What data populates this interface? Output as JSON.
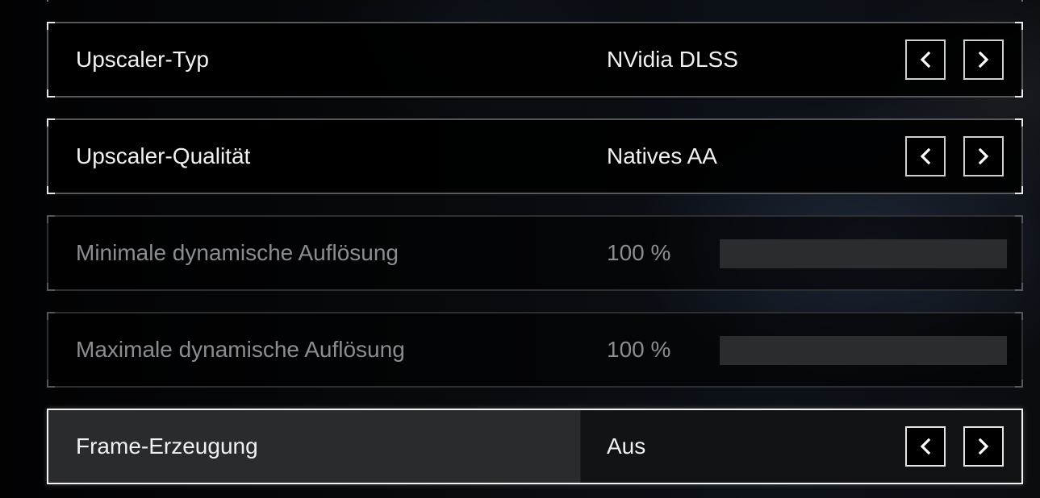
{
  "settings": [
    {
      "label": "Upscaler-Typ",
      "value": "NVidia DLSS",
      "control": "selector",
      "state": "normal"
    },
    {
      "label": "Upscaler-Qualität",
      "value": "Natives AA",
      "control": "selector",
      "state": "normal"
    },
    {
      "label": "Minimale dynamische Auflösung",
      "value": "100 %",
      "control": "slider",
      "state": "disabled"
    },
    {
      "label": "Maximale dynamische Auflösung",
      "value": "100 %",
      "control": "slider",
      "state": "disabled"
    },
    {
      "label": "Frame-Erzeugung",
      "value": "Aus",
      "control": "selector",
      "state": "selected"
    }
  ],
  "icons": {
    "prev": "chevron-left-icon",
    "next": "chevron-right-icon"
  },
  "colors": {
    "text": "#f1f1f1",
    "text_disabled": "#8b8d90",
    "selected_border": "#f2f2f2",
    "slider_track": "#2a2c2f"
  }
}
